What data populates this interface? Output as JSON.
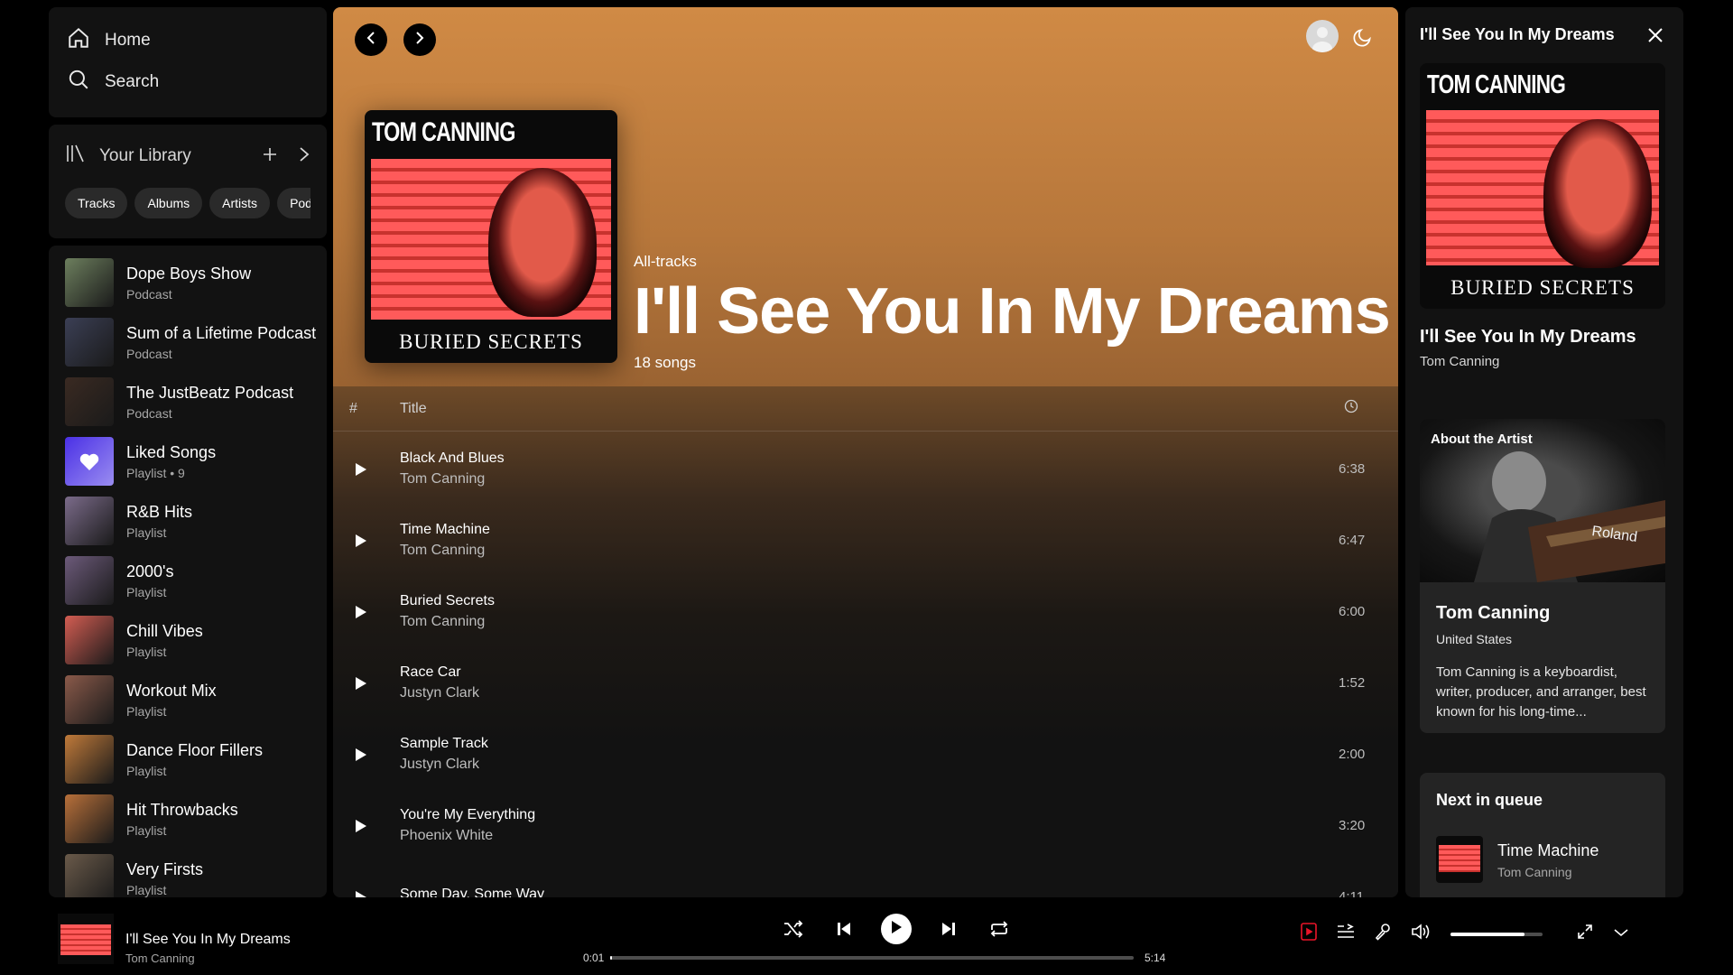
{
  "nav": {
    "home_label": "Home",
    "search_label": "Search"
  },
  "library": {
    "title": "Your Library",
    "chips": [
      "Tracks",
      "Albums",
      "Artists",
      "Podca"
    ]
  },
  "playlists": [
    {
      "name": "Dope Boys Show",
      "sub": "Podcast",
      "color": "#6d7f5e"
    },
    {
      "name": "Sum of a Lifetime Podcast",
      "sub": "Podcast",
      "color": "#3b3f55"
    },
    {
      "name": "The JustBeatz Podcast",
      "sub": "Podcast",
      "color": "#3a2a22"
    },
    {
      "name": "Liked Songs",
      "sub": "Playlist • 9",
      "color": "#6b4df0"
    },
    {
      "name": "R&B Hits",
      "sub": "Playlist",
      "color": "#7b6b8a"
    },
    {
      "name": "2000's",
      "sub": "Playlist",
      "color": "#6c5a7a"
    },
    {
      "name": "Chill Vibes",
      "sub": "Playlist",
      "color": "#d35d52"
    },
    {
      "name": "Workout Mix",
      "sub": "Playlist",
      "color": "#8a5a4a"
    },
    {
      "name": "Dance Floor Fillers",
      "sub": "Playlist",
      "color": "#c07a3a"
    },
    {
      "name": "Hit Throwbacks",
      "sub": "Playlist",
      "color": "#b8703a"
    },
    {
      "name": "Very Firsts",
      "sub": "Playlist",
      "color": "#6a5a4a"
    }
  ],
  "album": {
    "cover_title": "TOM CANNING",
    "cover_sub": "BURIED SECRETS",
    "type": "All-tracks",
    "title": "I'll See You In My Dreams",
    "count": "18 songs"
  },
  "table": {
    "col_num": "#",
    "col_title": "Title"
  },
  "tracks": [
    {
      "title": "Black And Blues",
      "artist": "Tom Canning",
      "duration": "6:38"
    },
    {
      "title": "Time Machine",
      "artist": "Tom Canning",
      "duration": "6:47"
    },
    {
      "title": "Buried Secrets",
      "artist": "Tom Canning",
      "duration": "6:00"
    },
    {
      "title": "Race Car",
      "artist": "Justyn Clark",
      "duration": "1:52"
    },
    {
      "title": "Sample Track",
      "artist": "Justyn Clark",
      "duration": "2:00"
    },
    {
      "title": "You're My Everything",
      "artist": "Phoenix White",
      "duration": "3:20"
    },
    {
      "title": "Some Day, Some Way",
      "artist": "",
      "duration": "4:11"
    }
  ],
  "right": {
    "title": "I'll See You In My Dreams",
    "song": "I'll See You In My Dreams",
    "artist": "Tom Canning",
    "about_label": "About the Artist",
    "about_name": "Tom Canning",
    "about_loc": "United States",
    "about_bio": "Tom Canning is a keyboardist, writer, producer, and arranger, best known for his long-time...",
    "queue_title": "Next in queue",
    "queue_song": "Time Machine",
    "queue_artist": "Tom Canning"
  },
  "player": {
    "title": "I'll See You In My Dreams",
    "artist": "Tom Canning",
    "elapsed": "0:01",
    "total": "5:14",
    "progress": 0.003,
    "volume": 0.8
  },
  "colors": {
    "accent": "#e91429",
    "hero": "#d08a45"
  }
}
